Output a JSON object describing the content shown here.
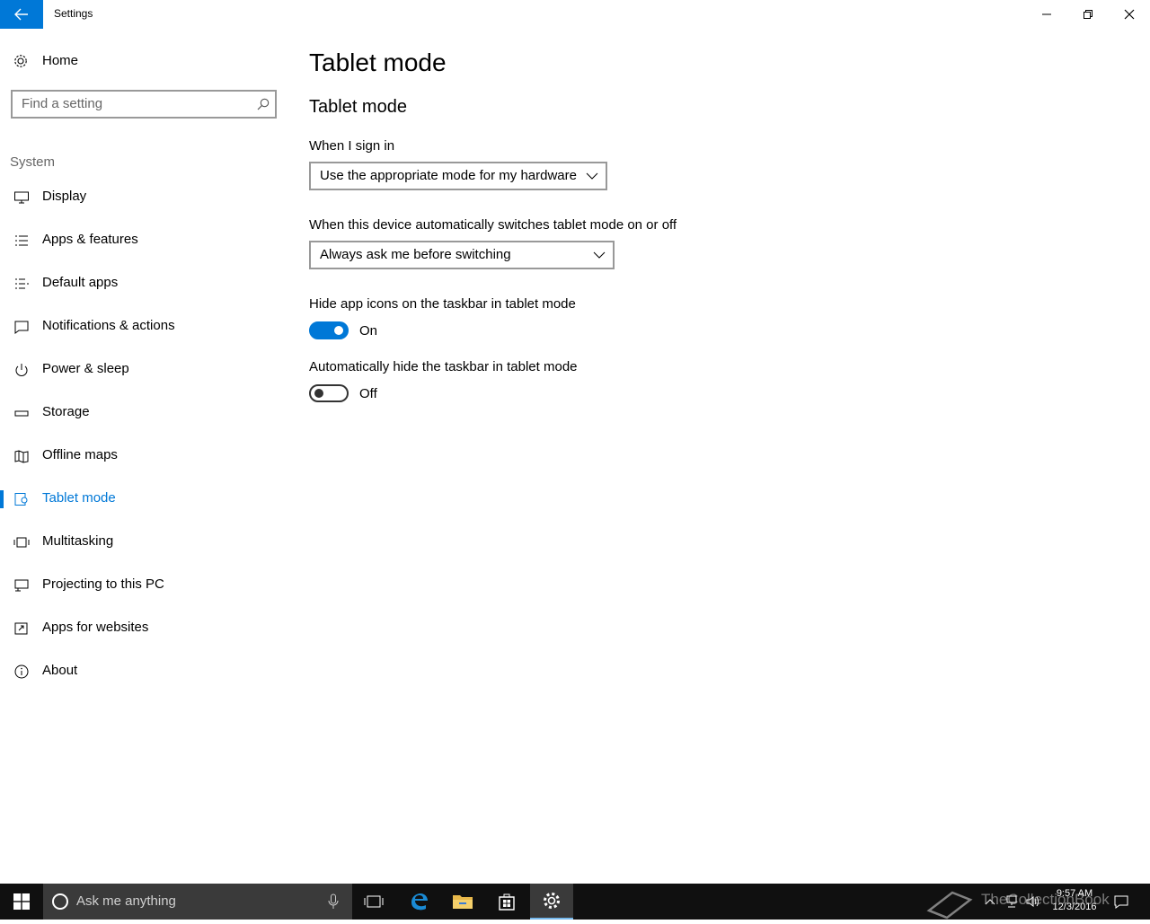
{
  "window": {
    "title": "Settings"
  },
  "sidebar": {
    "home_label": "Home",
    "search_placeholder": "Find a setting",
    "group_label": "System",
    "items": [
      {
        "label": "Display",
        "icon": "display-icon"
      },
      {
        "label": "Apps & features",
        "icon": "list-icon"
      },
      {
        "label": "Default apps",
        "icon": "default-apps-icon"
      },
      {
        "label": "Notifications & actions",
        "icon": "notification-icon"
      },
      {
        "label": "Power & sleep",
        "icon": "power-icon"
      },
      {
        "label": "Storage",
        "icon": "storage-icon"
      },
      {
        "label": "Offline maps",
        "icon": "map-icon"
      },
      {
        "label": "Tablet mode",
        "icon": "tablet-icon",
        "active": true
      },
      {
        "label": "Multitasking",
        "icon": "multitasking-icon"
      },
      {
        "label": "Projecting to this PC",
        "icon": "projecting-icon"
      },
      {
        "label": "Apps for websites",
        "icon": "apps-websites-icon"
      },
      {
        "label": "About",
        "icon": "info-icon"
      }
    ]
  },
  "main": {
    "page_title": "Tablet mode",
    "section_title": "Tablet mode",
    "sign_in": {
      "label": "When I sign in",
      "value": "Use the appropriate mode for my hardware"
    },
    "auto_switch": {
      "label": "When this device automatically switches tablet mode on or off",
      "value": "Always ask me before switching"
    },
    "hide_icons": {
      "label": "Hide app icons on the taskbar in tablet mode",
      "state": "On",
      "on": true
    },
    "hide_taskbar": {
      "label": "Automatically hide the taskbar in tablet mode",
      "state": "Off",
      "on": false
    }
  },
  "taskbar": {
    "search_placeholder": "Ask me anything",
    "time": "9:57 AM",
    "date": "12/3/2016",
    "watermark": "TheCollectionBook"
  },
  "colors": {
    "accent": "#0078d7",
    "taskbar": "#101010"
  }
}
